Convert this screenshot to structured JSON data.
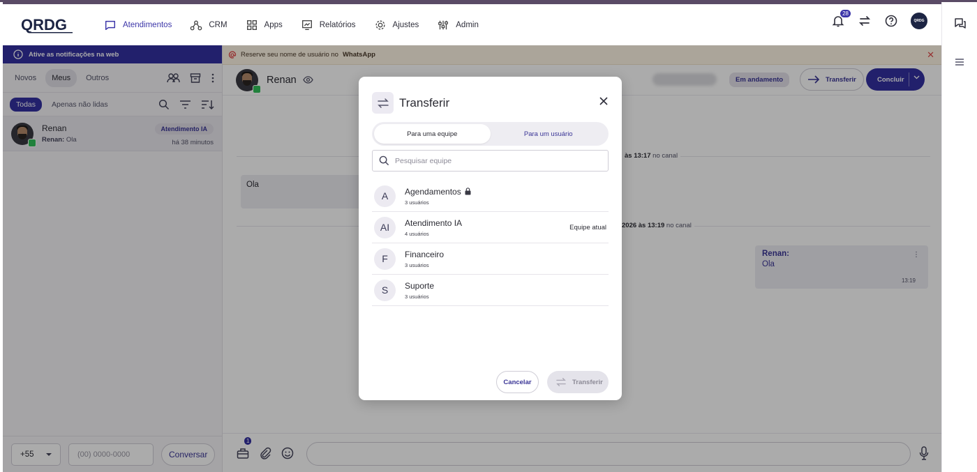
{
  "nav": {
    "items": [
      {
        "label": "Atendimentos",
        "icon": "chat-bubble-icon"
      },
      {
        "label": "CRM",
        "icon": "network-icon"
      },
      {
        "label": "Apps",
        "icon": "grid-icon"
      },
      {
        "label": "Relatórios",
        "icon": "report-icon"
      },
      {
        "label": "Ajustes",
        "icon": "gear-icon"
      },
      {
        "label": "Admin",
        "icon": "sliders-icon"
      }
    ],
    "notifications_count": "28",
    "org_avatar_text": "QRDG"
  },
  "logo": {
    "text": "QRDG"
  },
  "sidebar": {
    "notification_bar": "Ative as notificações na web",
    "tabs": [
      "Novos",
      "Meus",
      "Outros"
    ],
    "filters": {
      "all": "Todas",
      "unread": "Apenas não lidas"
    },
    "conversations": [
      {
        "name": "Renan",
        "sender": "Renan:",
        "last": "Ola",
        "tag": "Atendimento IA",
        "time": "há 38 minutos"
      }
    ],
    "bottom": {
      "ddi": "+55",
      "phone_placeholder": "(00) 0000-0000",
      "button": "Conversar"
    }
  },
  "main": {
    "warning_text": "Reserve seu nome de usuário no",
    "warning_bold": "WhatsApp",
    "contact_name": "Renan",
    "status": "Em andamento",
    "transfer_label": "Transferir",
    "conclude_label": "Concluir",
    "day1": {
      "time": "às 13:17",
      "suffix": "no canal"
    },
    "day2": {
      "time": "2026 às 13:19",
      "suffix": "no canal"
    },
    "incoming_message": "Ola",
    "outgoing": {
      "sender": "Renan:",
      "message": "Ola",
      "time": "13:19"
    },
    "composer_badge": "1"
  },
  "modal": {
    "title": "Transferir",
    "segments": [
      "Para uma equipe",
      "Para um usuário"
    ],
    "search_placeholder": "Pesquisar equipe",
    "teams": [
      {
        "initial": "A",
        "name": "Agendamentos",
        "count": "3 usuários",
        "locked": true,
        "current": ""
      },
      {
        "initial": "AI",
        "name": "Atendimento IA",
        "count": "4 usuários",
        "locked": false,
        "current": "Equipe atual"
      },
      {
        "initial": "F",
        "name": "Financeiro",
        "count": "3 usuários",
        "locked": false,
        "current": ""
      },
      {
        "initial": "S",
        "name": "Suporte",
        "count": "3 usuários",
        "locked": false,
        "current": ""
      }
    ],
    "cancel_label": "Cancelar",
    "transfer_label": "Transferir"
  },
  "colors": {
    "brand": "#3430a2",
    "warning_bg": "#fff6e6",
    "whatsapp": "#32c15a"
  }
}
